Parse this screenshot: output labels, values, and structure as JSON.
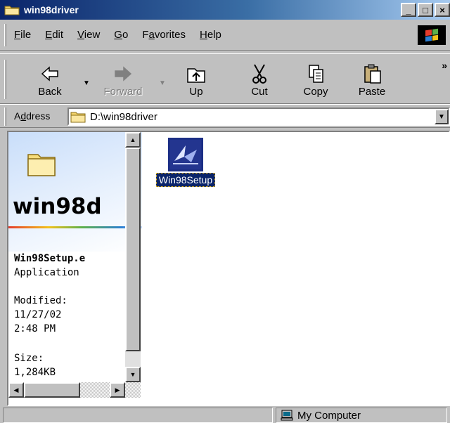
{
  "window": {
    "title": "win98driver",
    "buttons": {
      "minimize": "_",
      "maximize": "□",
      "close": "×"
    }
  },
  "menu": [
    {
      "ul": "F",
      "rest": "ile"
    },
    {
      "ul": "E",
      "rest": "dit"
    },
    {
      "ul": "V",
      "rest": "iew"
    },
    {
      "ul": "G",
      "rest": "o"
    },
    {
      "pre": "F",
      "ul": "a",
      "rest": "vorites"
    },
    {
      "ul": "H",
      "rest": "elp"
    }
  ],
  "toolbar": {
    "back": "Back",
    "forward": "Forward",
    "up": "Up",
    "cut": "Cut",
    "copy": "Copy",
    "paste": "Paste",
    "more": "»"
  },
  "address": {
    "label_pre": "A",
    "label_ul": "d",
    "label_rest": "dress",
    "value": "D:\\win98driver"
  },
  "webpanel": {
    "folder_title": "win98d",
    "selected_name": "Win98Setup.e",
    "selected_type": "Application",
    "modified_label": "Modified:",
    "modified_date": "11/27/02",
    "modified_time": "2:48 PM",
    "size_label": "Size:",
    "size_value": "1,284KB"
  },
  "files": [
    {
      "name": "Win98Setup",
      "icon": "installer-icon",
      "selected": true
    }
  ],
  "statusbar": {
    "zone": "My Computer",
    "zone_icon": "computer-icon"
  },
  "colors": {
    "title_bar": "#0a246a",
    "face": "#c0c0c0",
    "selection": "#0a246a"
  }
}
